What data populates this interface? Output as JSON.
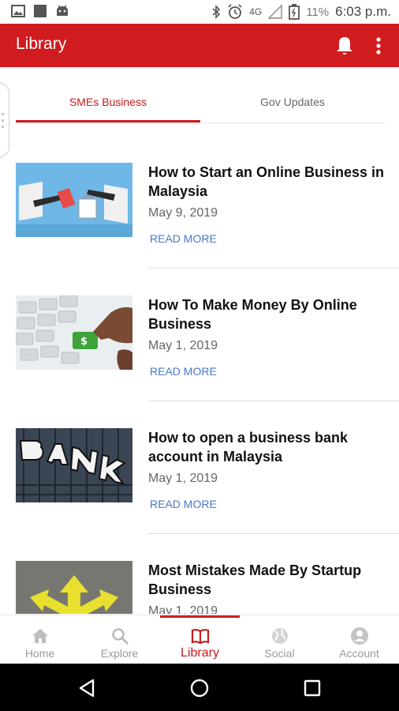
{
  "status_bar": {
    "battery_percent": "11%",
    "time": "6:03 p.m.",
    "network": "4G"
  },
  "app_bar": {
    "title": "Library",
    "bg_color": "#d01c1f"
  },
  "tabs": [
    {
      "label": "SMEs Business",
      "active": true
    },
    {
      "label": "Gov Updates",
      "active": false
    }
  ],
  "articles": [
    {
      "title": "How to Start an Online Business in Malaysia",
      "date": "May 9, 2019",
      "cta": "READ MORE",
      "thumb": "online-shopping"
    },
    {
      "title": "How To Make Money By Online Business",
      "date": "May 1, 2019",
      "cta": "READ MORE",
      "thumb": "keyboard-dollar-key"
    },
    {
      "title": "How to open a business bank account in Malaysia",
      "date": "May 1, 2019",
      "cta": "READ MORE",
      "thumb": "bank-sign"
    },
    {
      "title": "Most Mistakes Made By Startup Business",
      "date": "May 1, 2019",
      "cta": "",
      "thumb": "road-arrows"
    }
  ],
  "bottom_nav": [
    {
      "label": "Home",
      "icon": "home-icon",
      "active": false
    },
    {
      "label": "Explore",
      "icon": "search-icon",
      "active": false
    },
    {
      "label": "Library",
      "icon": "book-icon",
      "active": true
    },
    {
      "label": "Social",
      "icon": "globe-icon",
      "active": false
    },
    {
      "label": "Account",
      "icon": "account-icon",
      "active": false
    }
  ],
  "colors": {
    "accent": "#d01c1f",
    "link": "#4778c8",
    "inactive": "#9a9a9a"
  }
}
